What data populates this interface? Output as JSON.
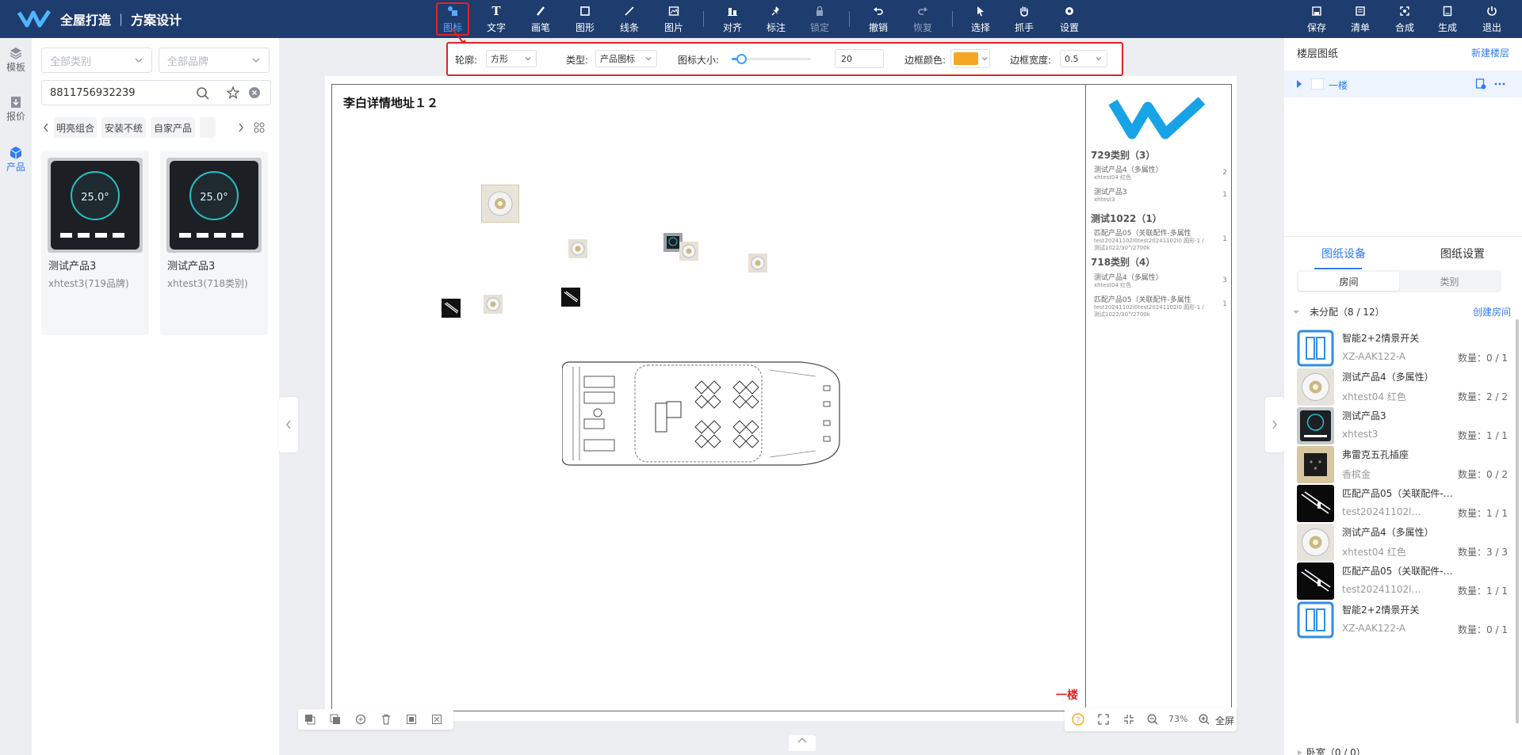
{
  "app": {
    "brand": "全屋打造",
    "separator": "|",
    "module": "方案设计"
  },
  "toolbar": {
    "tools": [
      {
        "label": "图标",
        "icon": "icon-tool-icon"
      },
      {
        "label": "文字",
        "icon": "text-icon"
      },
      {
        "label": "画笔",
        "icon": "brush-icon"
      },
      {
        "label": "图形",
        "icon": "shape-icon"
      },
      {
        "label": "线条",
        "icon": "line-icon"
      },
      {
        "label": "图片",
        "icon": "image-icon"
      },
      {
        "label": "对齐",
        "icon": "align-icon"
      },
      {
        "label": "标注",
        "icon": "pin-icon"
      },
      {
        "label": "锁定",
        "icon": "lock-icon"
      },
      {
        "label": "撤销",
        "icon": "undo-icon"
      },
      {
        "label": "恢复",
        "icon": "redo-icon"
      },
      {
        "label": "选择",
        "icon": "select-cursor-icon"
      },
      {
        "label": "抓手",
        "icon": "hand-icon"
      },
      {
        "label": "设置",
        "icon": "gear-icon"
      }
    ],
    "right": [
      {
        "label": "保存",
        "icon": "save-icon"
      },
      {
        "label": "清单",
        "icon": "list-icon"
      },
      {
        "label": "合成",
        "icon": "compose-icon"
      },
      {
        "label": "生成",
        "icon": "generate-icon"
      },
      {
        "label": "退出",
        "icon": "exit-icon"
      }
    ]
  },
  "leftnav": [
    {
      "label": "模板",
      "icon": "layers-icon"
    },
    {
      "label": "报价",
      "icon": "quote-icon"
    },
    {
      "label": "产品",
      "icon": "cube-icon"
    }
  ],
  "filters": {
    "category_placeholder": "全部类别",
    "brand_placeholder": "全部品牌",
    "search_value": "8811756932239"
  },
  "tags": [
    "明亮组合",
    "安装不统",
    "自家产品"
  ],
  "products": [
    {
      "name": "测试产品3",
      "sub": "xhtest3(719品牌)"
    },
    {
      "name": "测试产品3",
      "sub": "xhtest3(718类别)"
    }
  ],
  "propbar": {
    "outline_label": "轮廓:",
    "outline_value": "方形",
    "type_label": "类型:",
    "type_value": "产品图标",
    "size_label": "图标大小:",
    "size_value": "20",
    "size_slider_fraction": 0.12,
    "border_color_label": "边框颜色:",
    "border_color": "#f5a623",
    "border_width_label": "边框宽度:",
    "border_width_value": "0.5"
  },
  "canvas": {
    "title": "李白详情地址１２",
    "floor_label": "一楼",
    "zoom": "73%",
    "fullscreen": "全屏",
    "legend": {
      "groups": [
        {
          "title": "729类别（3）",
          "items": [
            {
              "name": "测试产品4（多属性）",
              "sub": "xhtest04 红色",
              "count": "2"
            },
            {
              "name": "测试产品3",
              "sub": "xhtest3",
              "count": "1"
            }
          ]
        },
        {
          "title": "测试1022（1）",
          "items": [
            {
              "name": "匹配产品05（关联配件-多属性",
              "sub": "test20241102l0test20241102l0 圆形-1 /测试1022/30°/2700k",
              "count": "1"
            }
          ]
        },
        {
          "title": "718类别（4）",
          "items": [
            {
              "name": "测试产品4（多属性）",
              "sub": "xhtest04 红色",
              "count": "3"
            },
            {
              "name": "匹配产品05（关联配件-多属性",
              "sub": "test20241102l0test20241102l0 圆形-1 /测试1022/30°/2700k",
              "count": "1"
            }
          ]
        }
      ]
    }
  },
  "rightpanel": {
    "title": "楼层图纸",
    "new_floor": "新建楼层",
    "floor_name": "一楼",
    "tabs": [
      "图纸设备",
      "图纸设置"
    ],
    "seg": [
      "房间",
      "类别"
    ],
    "group": {
      "title": "未分配（8 / 12）",
      "action": "创建房间"
    },
    "devices": [
      {
        "name": "智能2+2情景开关",
        "sub": "XZ-AAK122-A",
        "qty": "数量：0 / 1",
        "thumb": "switch"
      },
      {
        "name": "测试产品4（多属性）",
        "sub": "xhtest04 红色",
        "qty": "数量：2 / 2",
        "thumb": "light"
      },
      {
        "name": "测试产品3",
        "sub": "xhtest3",
        "qty": "数量：1 / 1",
        "thumb": "thermo"
      },
      {
        "name": "弗雷克五孔插座",
        "sub": "香槟金",
        "qty": "数量：0 / 2",
        "thumb": "socket"
      },
      {
        "name": "匹配产品05（关联配件-多属性...",
        "sub": "test20241102l0t...",
        "qty": "数量：1 / 1",
        "thumb": "track"
      },
      {
        "name": "测试产品4（多属性）",
        "sub": "xhtest04 红色",
        "qty": "数量：3 / 3",
        "thumb": "light"
      },
      {
        "name": "匹配产品05（关联配件-多属性...",
        "sub": "test20241102l0t...",
        "qty": "数量：1 / 1",
        "thumb": "track"
      },
      {
        "name": "智能2+2情景开关",
        "sub": "XZ-AAK122-A",
        "qty": "数量：0 / 1",
        "thumb": "switch"
      }
    ],
    "next_group": "卧室（0 / 0）"
  }
}
